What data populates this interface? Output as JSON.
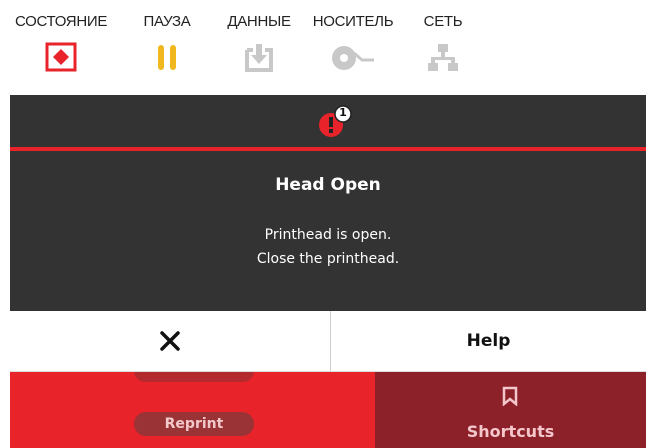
{
  "status_bar": {
    "items": [
      {
        "label": "СОСТОЯНИЕ",
        "icon": "status-error-icon",
        "color": "#e8232a"
      },
      {
        "label": "ПАУЗА",
        "icon": "pause-icon",
        "color": "#f0b81e"
      },
      {
        "label": "ДАННЫЕ",
        "icon": "data-download-icon",
        "color": "#c8c8c8"
      },
      {
        "label": "НОСИТЕЛЬ",
        "icon": "media-roll-icon",
        "color": "#c8c8c8"
      },
      {
        "label": "СЕТЬ",
        "icon": "network-icon",
        "color": "#c8c8c8"
      }
    ]
  },
  "alert": {
    "badge_count": "1",
    "accent_color": "#e8232a"
  },
  "modal": {
    "title": "Head Open",
    "message_line1": "Printhead is open.",
    "message_line2": "Close the printhead.",
    "close_icon": "close-icon",
    "help_label": "Help"
  },
  "home": {
    "reprint_label": "Reprint",
    "shortcuts_label": "Shortcuts",
    "shortcuts_icon": "bookmark-icon"
  }
}
